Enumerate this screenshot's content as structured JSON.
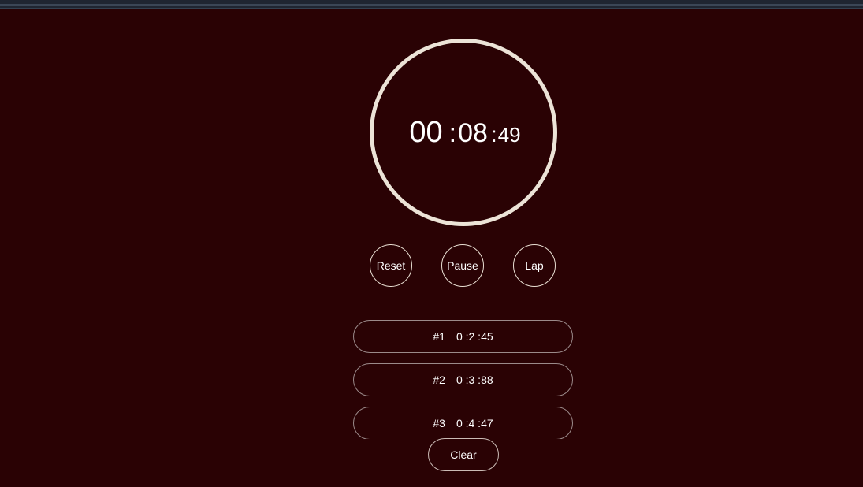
{
  "stopwatch": {
    "minutes": "00",
    "sep1": ":",
    "seconds": "08",
    "sep2": ":",
    "millis": "49"
  },
  "controls": {
    "reset_label": "Reset",
    "pause_label": "Pause",
    "lap_label": "Lap"
  },
  "laps": [
    {
      "number": "#1",
      "time": "0 :2 :45"
    },
    {
      "number": "#2",
      "time": "0 :3 :88"
    },
    {
      "number": "#3",
      "time": "0 :4 :47"
    }
  ],
  "clear_label": "Clear",
  "colors": {
    "background": "#2a0204",
    "ring": "#ece3d7",
    "text": "#ffffff"
  }
}
